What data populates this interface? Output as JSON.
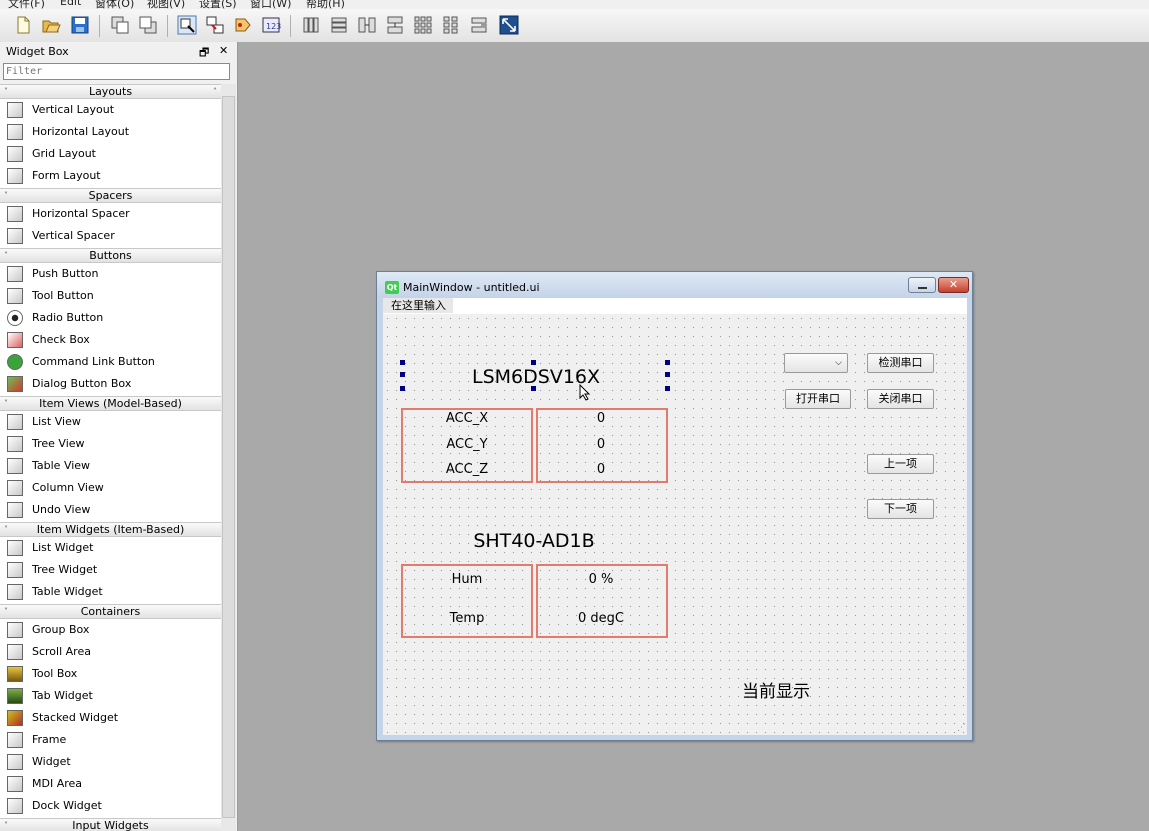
{
  "menubar": {
    "items": [
      "文件(F)",
      "Edit",
      "窗体(O)",
      "视图(V)",
      "设置(S)",
      "窗口(W)",
      "帮助(H)"
    ]
  },
  "toolbar": {
    "icons": [
      "new-file-icon",
      "open-folder-icon",
      "save-icon",
      "send-to-back-icon",
      "bring-to-front-icon",
      "edit-widgets-icon",
      "edit-signals-slots-icon",
      "edit-buddies-icon",
      "edit-tab-order-icon",
      "layout-horizontal-icon",
      "layout-vertical-icon",
      "layout-horizontal-splitter-icon",
      "layout-vertical-splitter-icon",
      "layout-grid-icon",
      "layout-form-icon",
      "break-layout-icon",
      "adjust-size-icon"
    ]
  },
  "widget_box": {
    "title": "Widget Box",
    "float_btn": "🗗",
    "close_btn": "✕",
    "filter_placeholder": "Filter",
    "categories": {
      "layouts": "Layouts",
      "spacers": "Spacers",
      "buttons": "Buttons",
      "item_views": "Item Views (Model-Based)",
      "item_widgets": "Item Widgets (Item-Based)",
      "containers": "Containers",
      "input_widgets": "Input Widgets"
    },
    "items": {
      "vertical_layout": "Vertical Layout",
      "horizontal_layout": "Horizontal Layout",
      "grid_layout": "Grid Layout",
      "form_layout": "Form Layout",
      "horizontal_spacer": "Horizontal Spacer",
      "vertical_spacer": "Vertical Spacer",
      "push_button": "Push Button",
      "tool_button": "Tool Button",
      "radio_button": "Radio Button",
      "check_box": "Check Box",
      "command_link_button": "Command Link Button",
      "dialog_button_box": "Dialog Button Box",
      "list_view": "List View",
      "tree_view": "Tree View",
      "table_view": "Table View",
      "column_view": "Column View",
      "undo_view": "Undo View",
      "list_widget": "List Widget",
      "tree_widget": "Tree Widget",
      "table_widget": "Table Widget",
      "group_box": "Group Box",
      "scroll_area": "Scroll Area",
      "tool_box": "Tool Box",
      "tab_widget": "Tab Widget",
      "stacked_widget": "Stacked Widget",
      "frame": "Frame",
      "widget": "Widget",
      "mdi_area": "MDI Area",
      "dock_widget": "Dock Widget"
    }
  },
  "form": {
    "title": "MainWindow - untitled.ui",
    "qt_badge": "Qt",
    "close_glyph": "✕",
    "menu_placeholder": "在这里输入",
    "sensor1_title": "LSM6DSV16X",
    "acc": {
      "x_label": "ACC_X",
      "y_label": "ACC_Y",
      "z_label": "ACC_Z",
      "x_value": "0",
      "y_value": "0",
      "z_value": "0"
    },
    "sensor2_title": "SHT40-AD1B",
    "hum_label": "Hum",
    "hum_value": "0 %",
    "temp_label": "Temp",
    "temp_value": "0 degC",
    "port_combo_value": "",
    "detect_port_button": "检测串口",
    "open_port_button": "打开串口",
    "close_port_button": "关闭串口",
    "prev_button": "上一项",
    "next_button": "下一项",
    "current_display_label": "当前显示"
  }
}
